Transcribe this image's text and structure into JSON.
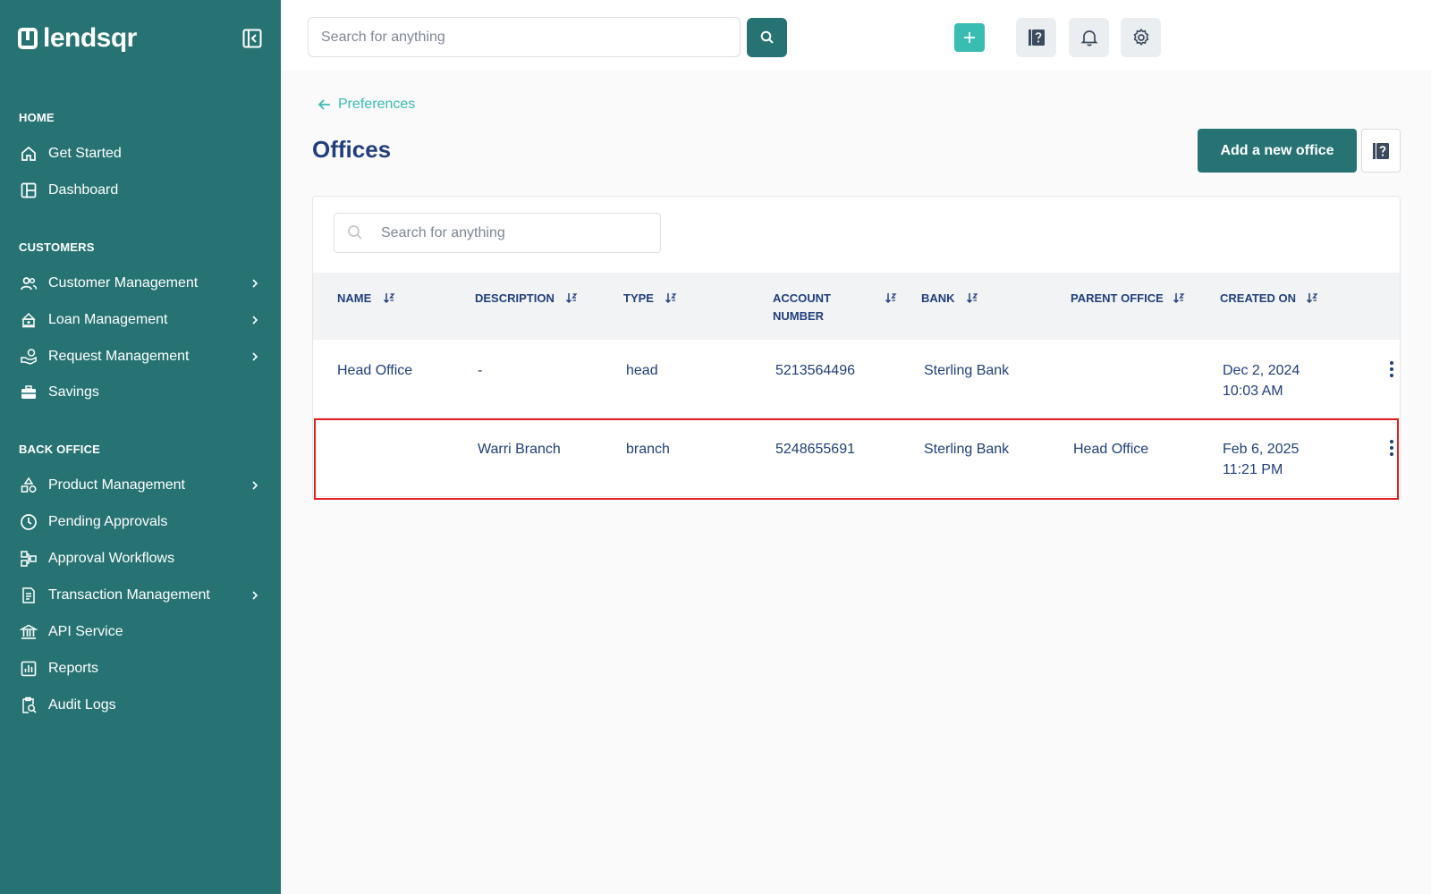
{
  "brand": {
    "name": "lendsqr"
  },
  "topbar": {
    "search_placeholder": "Search for anything"
  },
  "sidebar": {
    "sections": [
      {
        "label": "HOME"
      },
      {
        "label": "CUSTOMERS"
      },
      {
        "label": "BACK OFFICE"
      }
    ],
    "items": [
      {
        "label": "Get Started",
        "icon": "home-icon"
      },
      {
        "label": "Dashboard",
        "icon": "dashboard-icon"
      },
      {
        "label": "Customer Management",
        "icon": "users-icon"
      },
      {
        "label": "Loan Management",
        "icon": "loan-icon"
      },
      {
        "label": "Request Management",
        "icon": "request-icon"
      },
      {
        "label": "Savings",
        "icon": "savings-icon"
      },
      {
        "label": "Product Management",
        "icon": "product-icon"
      },
      {
        "label": "Pending Approvals",
        "icon": "clock-icon"
      },
      {
        "label": "Approval Workflows",
        "icon": "workflow-icon"
      },
      {
        "label": "Transaction Management",
        "icon": "transaction-icon"
      },
      {
        "label": "API Service",
        "icon": "bank-icon"
      },
      {
        "label": "Reports",
        "icon": "reports-icon"
      },
      {
        "label": "Audit Logs",
        "icon": "audit-icon"
      }
    ]
  },
  "main": {
    "back_label": "Preferences",
    "title": "Offices",
    "add_button": "Add a new office",
    "table_search_placeholder": "Search for anything",
    "columns": [
      {
        "label": "NAME"
      },
      {
        "label": "DESCRIPTION"
      },
      {
        "label": "TYPE"
      },
      {
        "label": "ACCOUNT NUMBER"
      },
      {
        "label": "BANK"
      },
      {
        "label": "PARENT OFFICE"
      },
      {
        "label": "CREATED ON"
      }
    ],
    "rows": [
      {
        "name": "Head Office",
        "description": "-",
        "type": "head",
        "account_number": "5213564496",
        "bank": "Sterling Bank",
        "parent_office": "",
        "created_date": "Dec 2, 2024",
        "created_time": "10:03 AM"
      },
      {
        "name": "",
        "description": "Warri Branch",
        "type": "branch",
        "account_number": "5248655691",
        "bank": "Sterling Bank",
        "parent_office": "Head Office",
        "created_date": "Feb 6, 2025",
        "created_time": "11:21 PM"
      }
    ]
  },
  "colors": {
    "sidebar_bg": "#277373",
    "accent": "#39bdb3",
    "text": "#213f7d",
    "highlight": "#e02020"
  }
}
